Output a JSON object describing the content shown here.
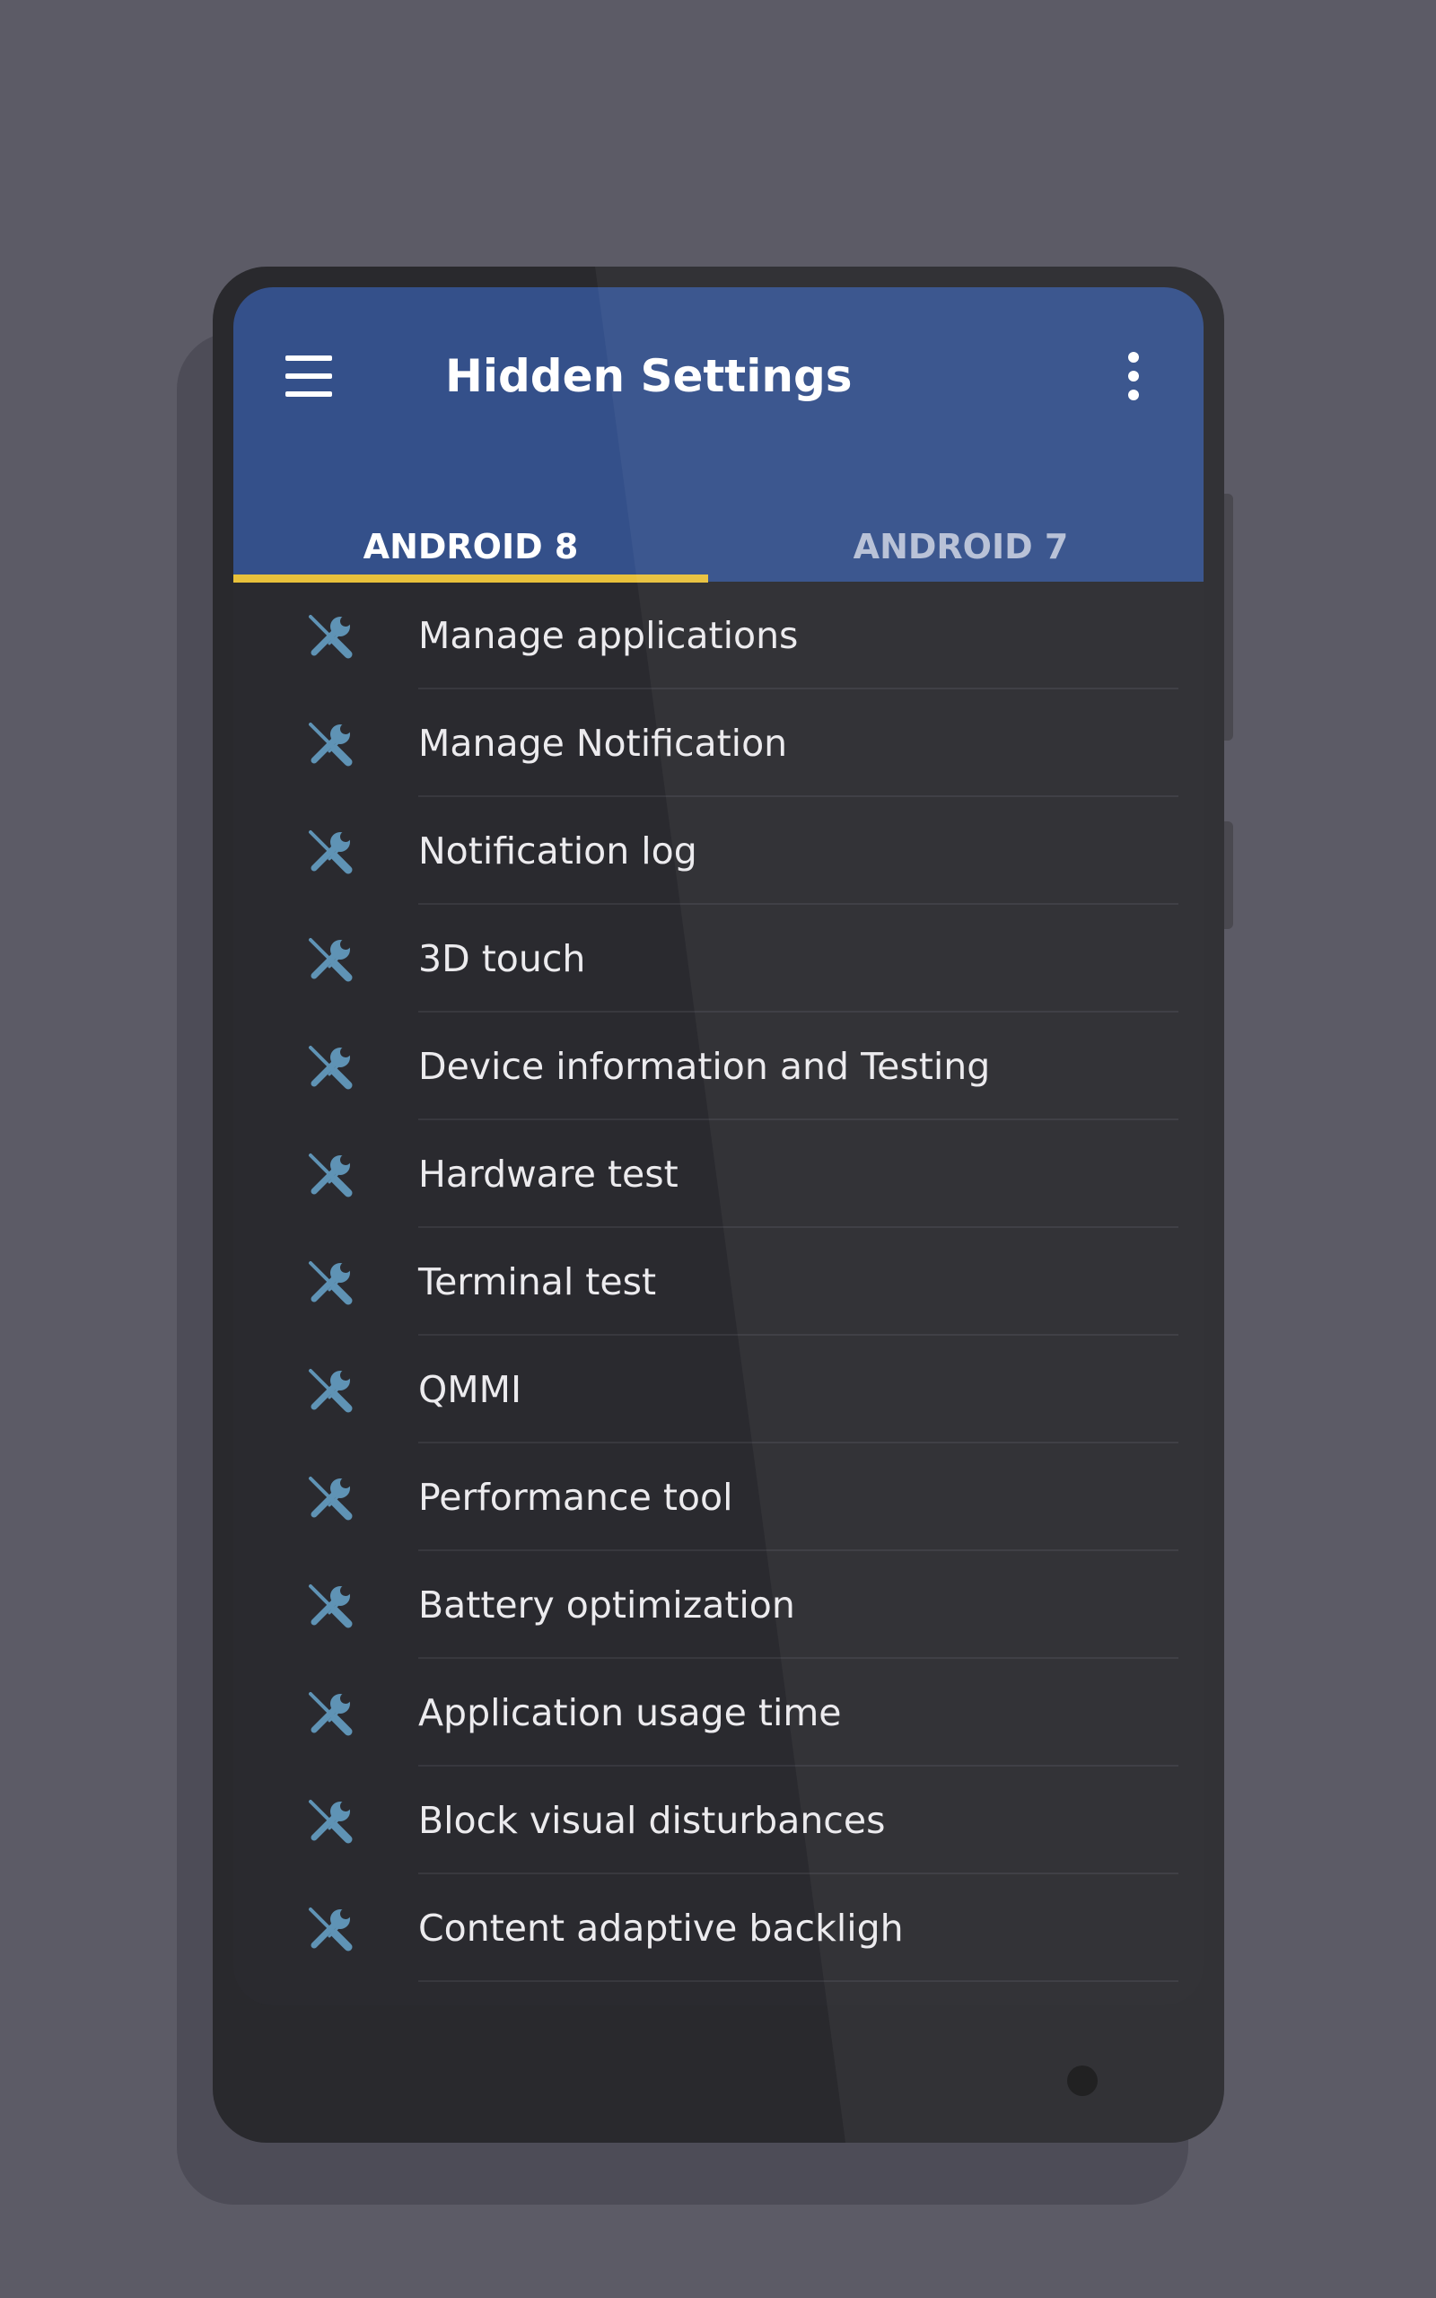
{
  "app_bar": {
    "title": "Hidden Settings",
    "menu_icon": "hamburger-menu-icon",
    "overflow_icon": "more-vert-icon",
    "background_color": "#34508a"
  },
  "tabs": [
    {
      "label": "ANDROID 8",
      "selected": true
    },
    {
      "label": "ANDROID 7",
      "selected": false
    }
  ],
  "tab_indicator_color": "#e8c13b",
  "list": {
    "icon": "wrench-screwdriver-icon",
    "icon_color": "#5f93b5",
    "items": [
      {
        "label": "Manage applications"
      },
      {
        "label": "Manage Notification"
      },
      {
        "label": "Notification log"
      },
      {
        "label": "3D touch"
      },
      {
        "label": "Device information and Testing"
      },
      {
        "label": "Hardware test"
      },
      {
        "label": "Terminal test"
      },
      {
        "label": "QMMI"
      },
      {
        "label": "Performance tool"
      },
      {
        "label": "Battery optimization"
      },
      {
        "label": "Application usage time"
      },
      {
        "label": "Block visual disturbances"
      },
      {
        "label": "Content adaptive backligh"
      }
    ]
  }
}
